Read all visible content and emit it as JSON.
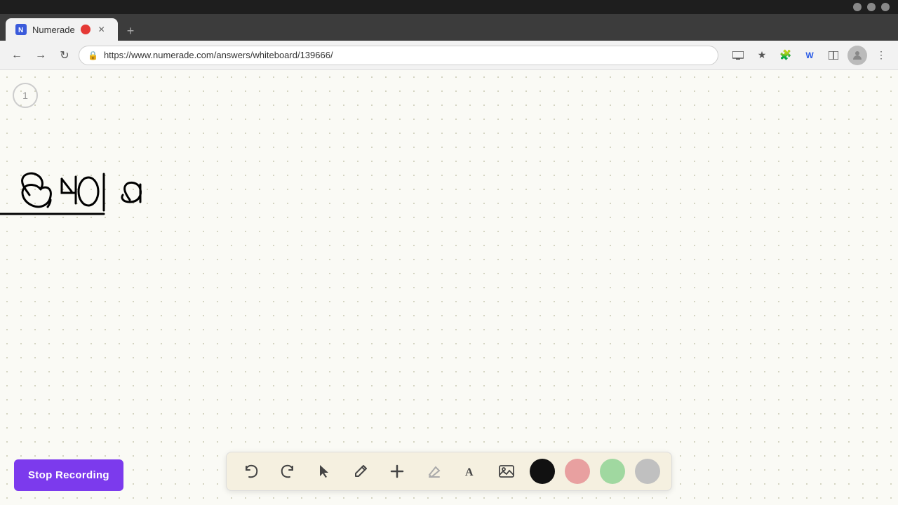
{
  "browser": {
    "tab_label": "Numerade",
    "url": "https://www.numerade.com/answers/whiteboard/139666/",
    "new_tab_label": "+"
  },
  "toolbar": {
    "undo_label": "↺",
    "redo_label": "↻",
    "select_label": "▶",
    "pen_label": "✏",
    "add_label": "+",
    "eraser_label": "⌫",
    "text_label": "A",
    "image_label": "🖼",
    "colors": [
      "#111111",
      "#e8a0a0",
      "#a0e0a0",
      "#c0c0c0"
    ]
  },
  "stop_recording_button": {
    "label": "Stop Recording"
  },
  "page_number": "1"
}
